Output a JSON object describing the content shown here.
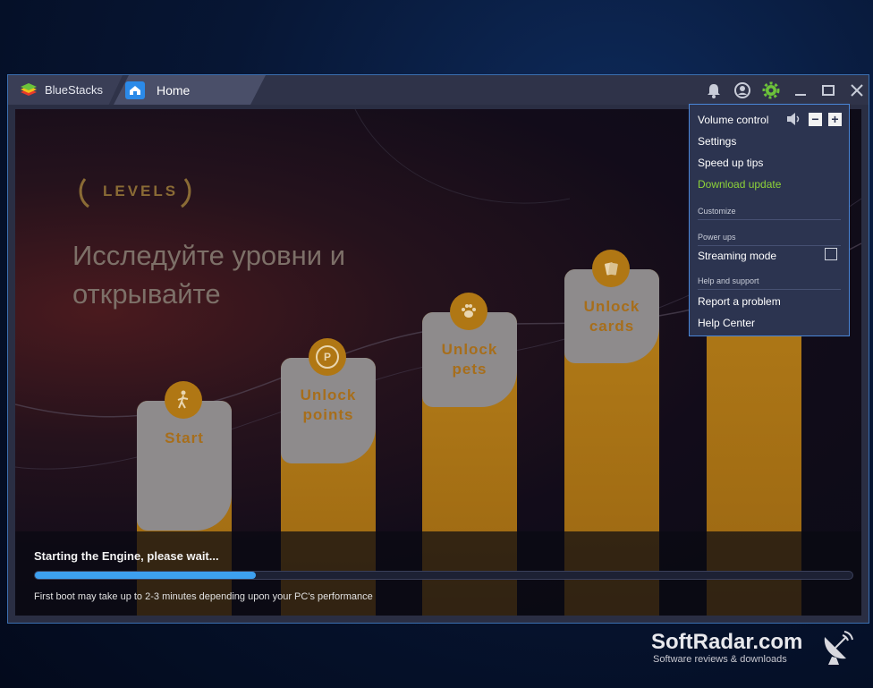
{
  "app": {
    "title": "BlueStacks"
  },
  "tabs": [
    {
      "label": "Home"
    }
  ],
  "content": {
    "levels_label": "LEVELS",
    "headline": "Исследуйте уровни и открывайте",
    "bars": [
      {
        "label": "Start",
        "icon": "walker-icon"
      },
      {
        "label": "Unlock points",
        "icon_text": "P"
      },
      {
        "label": "Unlock pets",
        "icon": "paw-icon"
      },
      {
        "label": "Unlock cards",
        "icon": "cards-icon"
      }
    ]
  },
  "loader": {
    "title": "Starting the Engine, please wait...",
    "progress": 0.27,
    "note": "First boot may take up to 2-3 minutes depending upon your PC's performance"
  },
  "menu": {
    "volume_control": "Volume control",
    "settings": "Settings",
    "speed_up_tips": "Speed up tips",
    "download_update": "Download update",
    "section_customize": "Customize",
    "section_power_ups": "Power ups",
    "streaming_mode": "Streaming mode",
    "section_help": "Help and support",
    "report_problem": "Report a problem",
    "help_center": "Help Center",
    "volume_minus": "−",
    "volume_plus": "+"
  },
  "watermark": {
    "title": "SoftRadar.com",
    "subtitle": "Software reviews & downloads"
  },
  "colors": {
    "accent": "#3da0f0",
    "update": "#8ed438",
    "gold": "#b47d18"
  }
}
